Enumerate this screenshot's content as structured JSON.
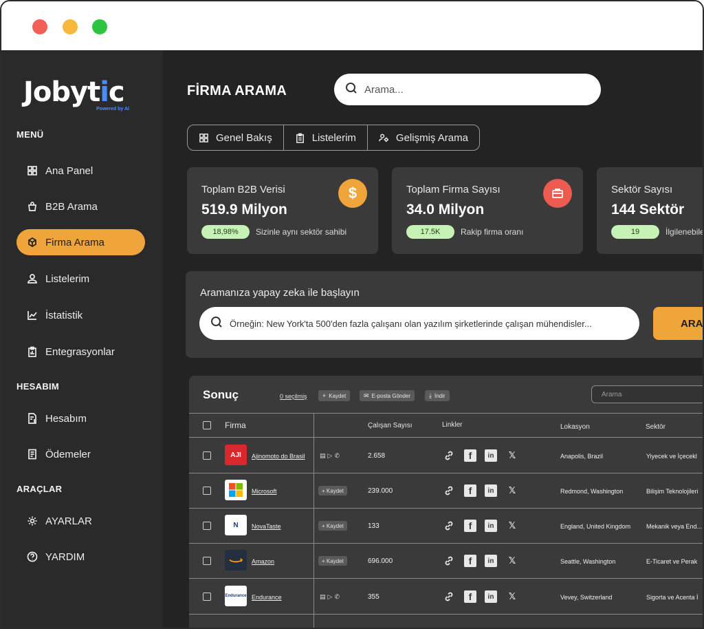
{
  "window": {
    "controls": [
      "close",
      "minimize",
      "maximize"
    ]
  },
  "brand": {
    "name_main": "Jobyt",
    "name_accent": "i",
    "name_tail": "c",
    "tagline": "Powered by AI"
  },
  "sidebar": {
    "menu_title": "MENÜ",
    "menu_items": [
      {
        "label": "Ana Panel",
        "icon": "grid-icon"
      },
      {
        "label": "B2B Arama",
        "icon": "bag-icon"
      },
      {
        "label": "Firma Arama",
        "icon": "box-icon",
        "active": true
      },
      {
        "label": "Listelerim",
        "icon": "user-icon"
      },
      {
        "label": "İstatistik",
        "icon": "chart-icon"
      },
      {
        "label": "Entegrasyonlar",
        "icon": "clipboard-icon"
      }
    ],
    "account_title": "HESABIM",
    "account_items": [
      {
        "label": "Hesabım",
        "icon": "document-money-icon"
      },
      {
        "label": "Ödemeler",
        "icon": "receipt-icon"
      }
    ],
    "tools_title": "ARAÇLAR",
    "tools_items": [
      {
        "label": "AYARLAR",
        "icon": "gear-icon"
      },
      {
        "label": "YARDIM",
        "icon": "help-icon"
      }
    ]
  },
  "header": {
    "title": "FİRMA ARAMA",
    "search_placeholder": "Arama..."
  },
  "tabs": [
    {
      "label": "Genel Bakış",
      "icon": "grid-icon"
    },
    {
      "label": "Listelerim",
      "icon": "clipboard-icon"
    },
    {
      "label": "Gelişmiş Arama",
      "icon": "users-gear-icon"
    }
  ],
  "stats": [
    {
      "label": "Toplam B2B Verisi",
      "value": "519.9 Milyon",
      "badge": "18,98%",
      "desc": "Sizinle aynı sektör sahibi",
      "icon": "$",
      "color": "#f0a53a"
    },
    {
      "label": "Toplam Firma Sayısı",
      "value": "34.0 Milyon",
      "badge": "17.5K",
      "desc": "Rakip firma oranı",
      "icon": "briefcase-icon",
      "color": "#ec5b4f"
    },
    {
      "label": "Sektör Sayısı",
      "value": "144 Sektör",
      "badge": "19",
      "desc": "İlgilenebile",
      "icon": "",
      "color": ""
    }
  ],
  "ai": {
    "title": "Aramanıza yapay zeka ile başlayın",
    "placeholder": "Örneğin: New York'ta 500'den fazla çalışanı olan yazılım şirketlerinde çalışan mühendisler...",
    "button": "ARAM"
  },
  "results": {
    "title": "Sonuç",
    "selected": "0 seçilmiş",
    "actions": [
      "Kaydet",
      "E-posta Gönder",
      "İndir"
    ],
    "search_placeholder": "Arama",
    "columns": [
      "Firma",
      "Çalışan Sayısı",
      "Linkler",
      "Lokasyon",
      "Sektör"
    ],
    "row_save_label": "Kaydet",
    "rows": [
      {
        "name": "Ajinomoto do Brasil",
        "employees": "2.658",
        "location": "Anapolis, Brazil",
        "sector": "Yiyecek ve İçecekl",
        "mode": "icons",
        "logo_bg": "#d9272e",
        "logo_text": "AJI"
      },
      {
        "name": "Microsoft",
        "employees": "239.000",
        "location": "Redmond, Washington",
        "sector": "Bilişim Teknolojileri",
        "mode": "save",
        "logo_bg": "#ffffff",
        "logo_text": ""
      },
      {
        "name": "NovaTaste",
        "employees": "133",
        "location": "England, United Kingdom",
        "sector": "Mekanik veya End...",
        "mode": "save",
        "logo_bg": "#ffffff",
        "logo_text": "N"
      },
      {
        "name": "Amazon",
        "employees": "696.000",
        "location": "Seattle, Washington",
        "sector": "E-Ticaret ve Perak",
        "mode": "save",
        "logo_bg": "#232f3e",
        "logo_text": "a"
      },
      {
        "name": "Endurance",
        "employees": "355",
        "location": "Vevey, Switzerland",
        "sector": "Sigorta ve Acenta İ",
        "mode": "icons",
        "logo_bg": "#ffffff",
        "logo_text": "Endurance"
      }
    ]
  }
}
